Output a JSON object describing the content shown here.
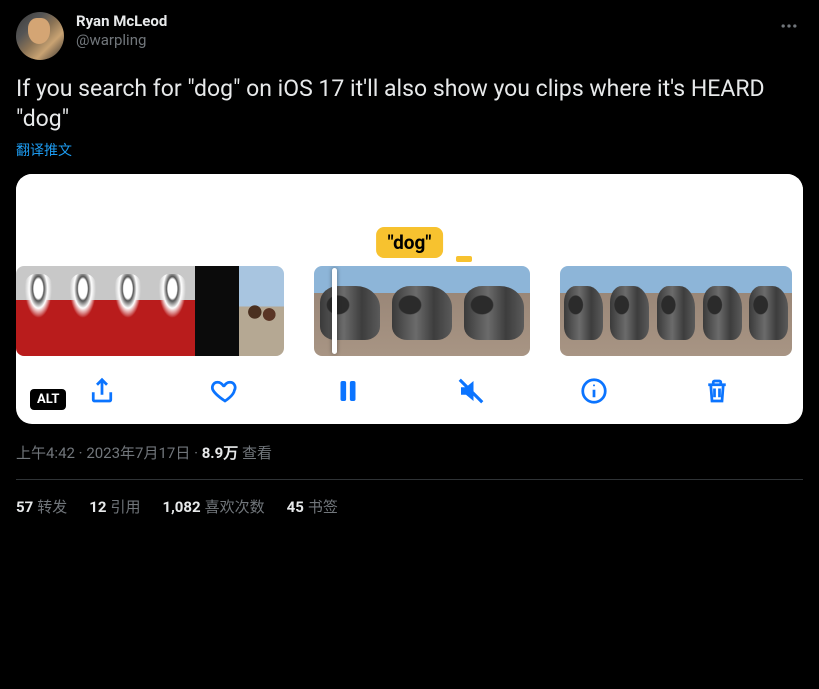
{
  "author": {
    "display_name": "Ryan McLeod",
    "handle": "@warpling"
  },
  "tweet_text": "If you search for \"dog\" on iOS 17 it'll also show you clips where it's HEARD \"dog\"",
  "translate_label": "翻译推文",
  "media": {
    "search_tag": "\"dog\"",
    "alt_badge": "ALT"
  },
  "meta": {
    "time": "上午4:42",
    "date": "2023年7月17日",
    "views_count": "8.9万",
    "views_label": "查看"
  },
  "stats": {
    "retweets_count": "57",
    "retweets_label": "转发",
    "quotes_count": "12",
    "quotes_label": "引用",
    "likes_count": "1,082",
    "likes_label": "喜欢次数",
    "bookmarks_count": "45",
    "bookmarks_label": "书签"
  }
}
